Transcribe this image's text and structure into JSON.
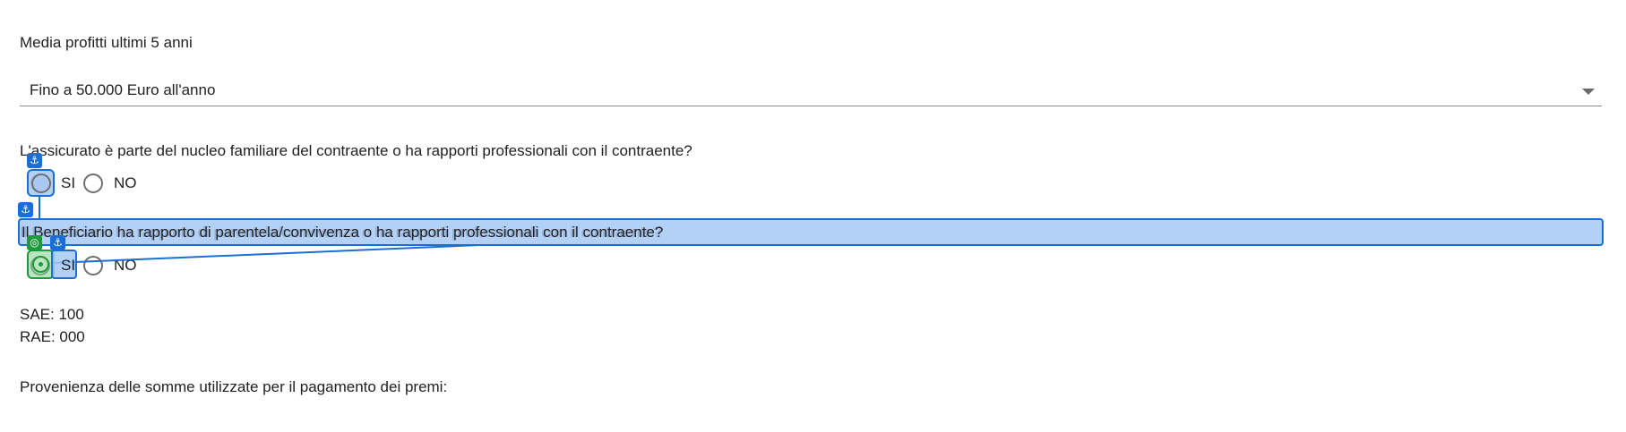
{
  "profits": {
    "label": "Media profitti ultimi 5 anni",
    "selected_value": "Fino a 50.000 Euro all'anno"
  },
  "question_insured": {
    "text": "L'assicurato è parte del nucleo familiare del contraente o ha rapporti professionali con il contraente?",
    "option_yes": "SI",
    "option_no": "NO"
  },
  "question_beneficiary": {
    "text": "Il Beneficiario ha rapporto di parentela/convivenza o ha rapporti professionali con il contraente?",
    "option_yes": "SI",
    "option_no": "NO"
  },
  "codes": {
    "sae": "SAE: 100",
    "rae": "RAE: 000"
  },
  "funds_origin": {
    "label": "Provenienza delle somme utilizzate per il pagamento dei premi:"
  },
  "annotations": {
    "anchor_glyph": "⚓",
    "target_glyph": "◎",
    "anchor_icon": "anchor-icon",
    "target_icon": "target-icon",
    "blue": "#1a6fd6",
    "green": "#1f9a3a"
  }
}
